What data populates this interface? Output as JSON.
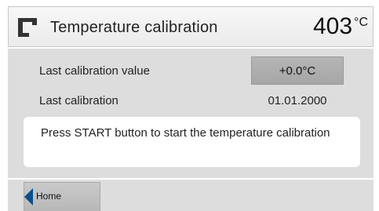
{
  "header": {
    "icon": "furnace-icon",
    "title": "Temperature calibration",
    "temperature": "403",
    "unit": "°C"
  },
  "calibration": {
    "last_value_label": "Last calibration value",
    "last_value": "+0.0°C",
    "last_date_label": "Last calibration",
    "last_date": "01.01.2000"
  },
  "message": "Press START button to start the temperature calibration",
  "footer": {
    "home_label": "Home"
  },
  "colors": {
    "accent": "#0b4f8a",
    "panel": "#dddddd",
    "button": "#b0b0b0"
  }
}
